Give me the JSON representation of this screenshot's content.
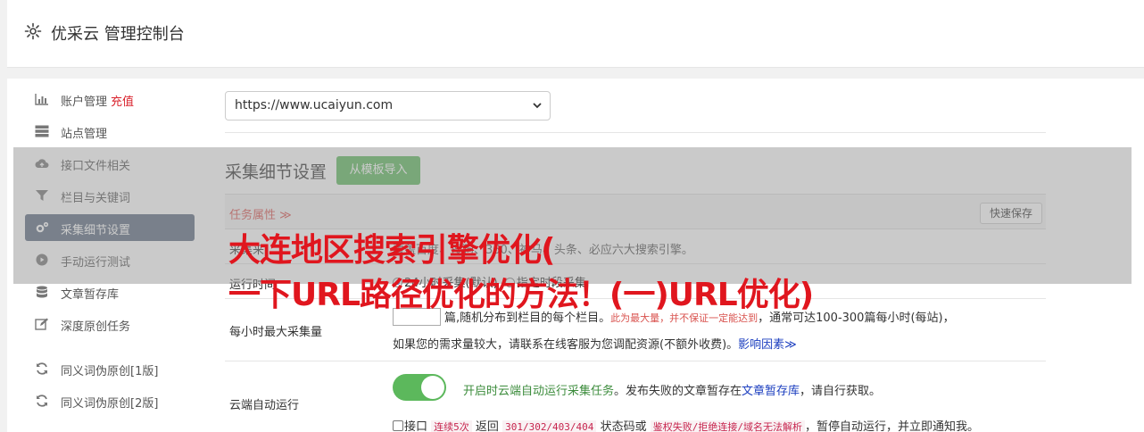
{
  "header": {
    "title": "优采云 管理控制台"
  },
  "sidebar": {
    "items": [
      {
        "label": "账户管理",
        "tag": "充值",
        "icon": "bar-chart-icon"
      },
      {
        "label": "站点管理",
        "icon": "server-icon"
      },
      {
        "label": "接口文件相关",
        "icon": "cloud-upload-icon"
      },
      {
        "label": "栏目与关键词",
        "icon": "filter-icon"
      },
      {
        "label": "采集细节设置",
        "icon": "gears-icon"
      },
      {
        "label": "手动运行测试",
        "icon": "play-circle-icon"
      },
      {
        "label": "文章暂存库",
        "icon": "database-icon"
      },
      {
        "label": "深度原创任务",
        "icon": "edit-icon"
      },
      {
        "label": "同义词伪原创[1版]",
        "icon": "refresh-icon"
      },
      {
        "label": "同义词伪原创[2版]",
        "icon": "refresh-icon"
      }
    ],
    "active_index": 4
  },
  "site_select": {
    "value": "https://www.ucaiyun.com"
  },
  "section": {
    "title": "采集细节设置",
    "template_button": "从模板导入"
  },
  "table": {
    "task_attr": "任务属性 ≫",
    "quick_save": "快速保存",
    "rows": {
      "source": {
        "key": "采集来",
        "value": "覆盖百度、搜狗、360、神马、头条、必应六大搜索引擎。"
      },
      "run_time": {
        "key": "运行时间",
        "opt1": "24小时采集(默认)",
        "opt2": "指定时段采集"
      },
      "max_rate": {
        "key": "每小时最大采集量",
        "num": "",
        "line1_a": "篇,随机分布到栏目的每个栏目。",
        "line1_hint": "此为最大量，并不保证一定能达到",
        "line1_b": "，通常可达100-300篇每小时(每站)，",
        "line2": "如果您的需求量较大，请联系在线客服为您调配资源(不额外收费)。",
        "line2_link": "影响因素≫"
      },
      "cloud_run": {
        "key": "云端自动运行",
        "toggle_on": true,
        "auto_green": "开启时云端自动运行采集任务",
        "auto_rest1": "。发布失败的文章暂存在",
        "auto_link": "文章暂存库",
        "auto_rest2": "，请自行获取。",
        "fail_a": "接口",
        "fail_code1": "连续5次",
        "fail_b": "返回",
        "fail_code2": "301/302/403/404",
        "fail_c": "状态码或",
        "fail_code3": "鉴权失败/拒绝连接/域名无法解析",
        "fail_d": "，暂停自动运行，并立即通知我。"
      }
    }
  },
  "overlay": {
    "line1": "大连地区搜索引擎优化(",
    "line2": "一下URL路径优化的方法！(一)URL优化)"
  },
  "colors": {
    "accent_red": "#e0161e",
    "active_nav": "#5c6b80",
    "green": "#5cb85c"
  }
}
